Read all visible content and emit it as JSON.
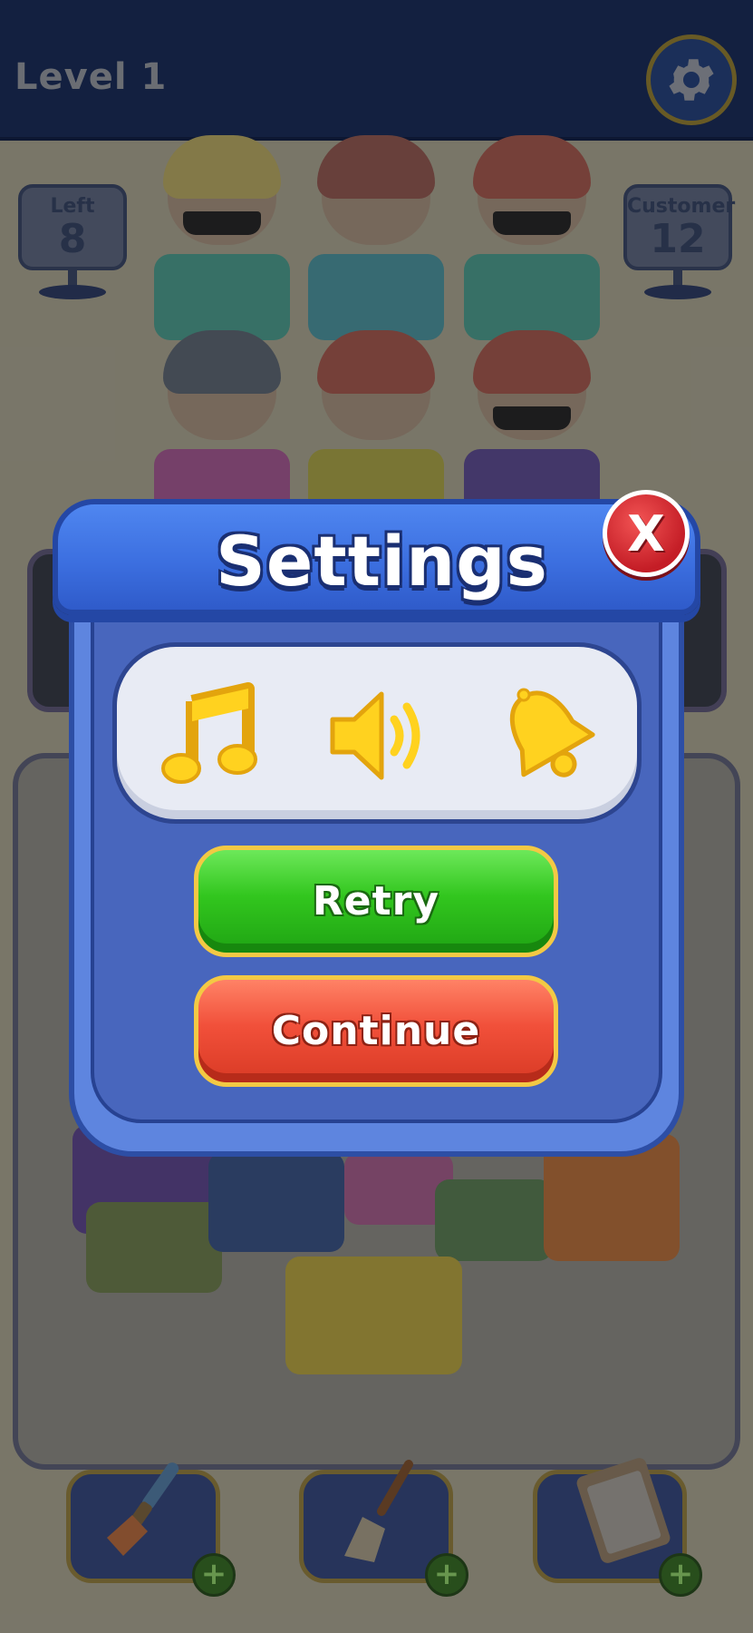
{
  "header": {
    "level_label": "Level 1"
  },
  "signs": {
    "left": {
      "title": "Left",
      "value": "8"
    },
    "customer": {
      "title": "Customer",
      "value": "12"
    }
  },
  "settings_dialog": {
    "title": "Settings",
    "close_label": "X",
    "toggles": [
      "music-icon",
      "sound-icon",
      "notification-bell-icon"
    ],
    "retry_label": "Retry",
    "continue_label": "Continue"
  },
  "toolbar": {
    "items": [
      "spatula-icon",
      "broom-icon",
      "clipboard-checklist-icon"
    ],
    "plus_label": "+"
  },
  "colors": {
    "dialog_blue": "#3c6fe0",
    "retry_green": "#32c61e",
    "continue_red": "#f1503a",
    "icon_yellow": "#ffd21f",
    "close_red": "#d4232c"
  }
}
